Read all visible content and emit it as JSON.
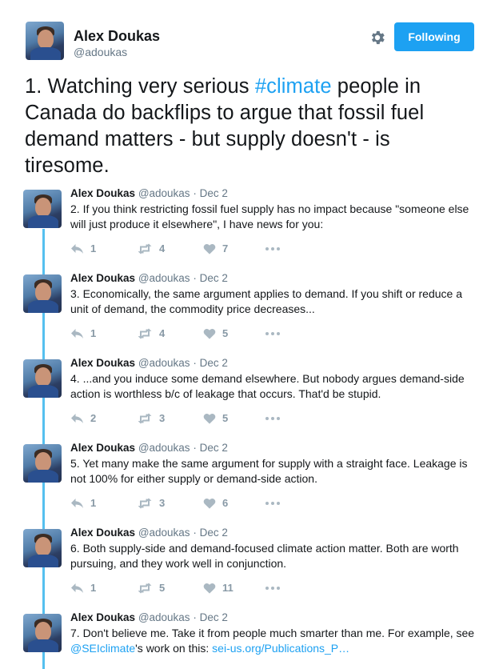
{
  "author": {
    "name": "Alex Doukas",
    "handle": "@adoukas",
    "follow_label": "Following"
  },
  "main_tweet": {
    "prefix": "1. Watching very serious ",
    "hashtag": "#climate",
    "suffix": " people in Canada do backflips to argue that fossil fuel demand matters - but supply doesn't - is tiresome."
  },
  "replies": [
    {
      "name": "Alex Doukas",
      "handle": "@adoukas",
      "date": "Dec 2",
      "text": "2. If you think restricting fossil fuel supply has no impact because \"someone else will just produce it elsewhere\", I have news for you:",
      "replies": "1",
      "retweets": "4",
      "likes": "7"
    },
    {
      "name": "Alex Doukas",
      "handle": "@adoukas",
      "date": "Dec 2",
      "text": "3. Economically, the same argument applies to demand. If you shift or reduce a unit of demand, the commodity price decreases...",
      "replies": "1",
      "retweets": "4",
      "likes": "5"
    },
    {
      "name": "Alex Doukas",
      "handle": "@adoukas",
      "date": "Dec 2",
      "text": "4. ...and you induce some demand elsewhere. But nobody argues demand-side action is worthless b/c of leakage that occurs. That'd be stupid.",
      "replies": "2",
      "retweets": "3",
      "likes": "5"
    },
    {
      "name": "Alex Doukas",
      "handle": "@adoukas",
      "date": "Dec 2",
      "text": "5. Yet many make the same argument for supply with a straight face. Leakage is not 100% for either supply or demand-side action.",
      "replies": "1",
      "retweets": "3",
      "likes": "6"
    },
    {
      "name": "Alex Doukas",
      "handle": "@adoukas",
      "date": "Dec 2",
      "text": "6. Both supply-side and demand-focused climate action matter. Both are worth pursuing, and they work well in conjunction.",
      "replies": "1",
      "retweets": "5",
      "likes": "11"
    },
    {
      "name": "Alex Doukas",
      "handle": "@adoukas",
      "date": "Dec 2",
      "text_before": "7. Don't believe me. Take it from people much smarter than me. For example, see ",
      "mention": "@SEIclimate",
      "text_middle": "'s work on this: ",
      "link": "sei-us.org/Publications_P…"
    }
  ],
  "colors": {
    "accent": "#1da1f2",
    "thread_line": "#55c0ef",
    "muted": "#657786"
  },
  "icons": [
    "gear-icon",
    "reply-icon",
    "retweet-icon",
    "like-icon",
    "more-icon"
  ]
}
